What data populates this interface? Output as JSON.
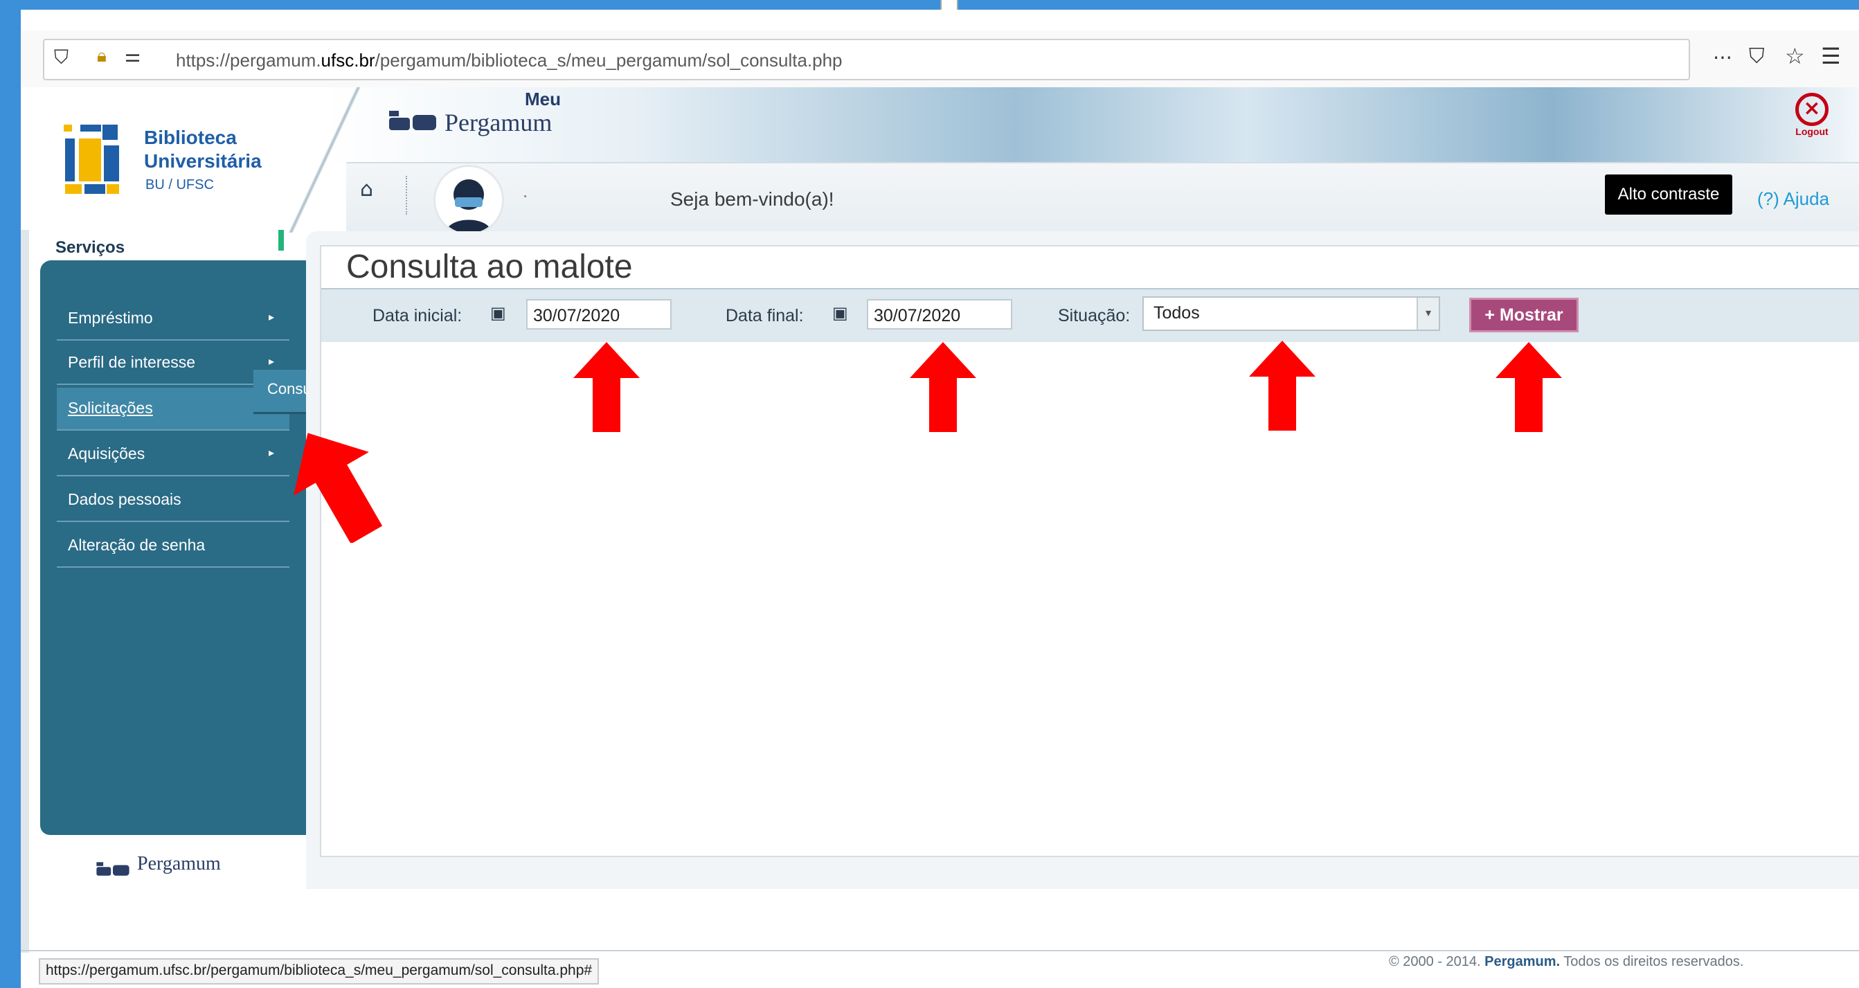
{
  "browser": {
    "url_prefix": "https://pergamum.",
    "url_domain": "ufsc.br",
    "url_path": "/pergamum/biblioteca_s/meu_pergamum/sol_consulta.php",
    "status_url": "https://pergamum.ufsc.br/pergamum/biblioteca_s/meu_pergamum/sol_consulta.php#"
  },
  "header": {
    "logo_line1": "Biblioteca",
    "logo_line2": "Universitária",
    "logo_sub": "BU / UFSC",
    "meu": "Meu",
    "pergamum": "Pergamum",
    "logout": "Logout",
    "welcome": "Seja bem-vindo(a)!",
    "alto_contraste": "Alto contraste",
    "ajuda": "(?) Ajuda",
    "dot": "·"
  },
  "sidebar": {
    "title": "Serviços",
    "items": [
      {
        "label": "Empréstimo",
        "arrow": "▸"
      },
      {
        "label": "Perfil de interesse",
        "arrow": "▸"
      },
      {
        "label": "Solicitações",
        "arrow": ""
      },
      {
        "label": "Aquisições",
        "arrow": "▸"
      },
      {
        "label": "Dados pessoais",
        "arrow": ""
      },
      {
        "label": "Alteração de senha",
        "arrow": ""
      }
    ],
    "submenu": "Consulta ao malote",
    "footer_logo": "Pergamum"
  },
  "main": {
    "title": "Consulta ao malote",
    "data_inicial_label": "Data inicial:",
    "data_inicial_value": "30/07/2020",
    "data_final_label": "Data final:",
    "data_final_value": "30/07/2020",
    "situacao_label": "Situação:",
    "situacao_value": "Todos",
    "mostrar_label": "+ Mostrar"
  },
  "footer": {
    "copyright_pre": "© 2000 - 2014. ",
    "copyright_brand": "Pergamum.",
    "copyright_post": " Todos os direitos reservados."
  },
  "colors": {
    "accent": "#2a6b86",
    "button": "#a8497c",
    "annotation_arrow": "#ff0000"
  }
}
